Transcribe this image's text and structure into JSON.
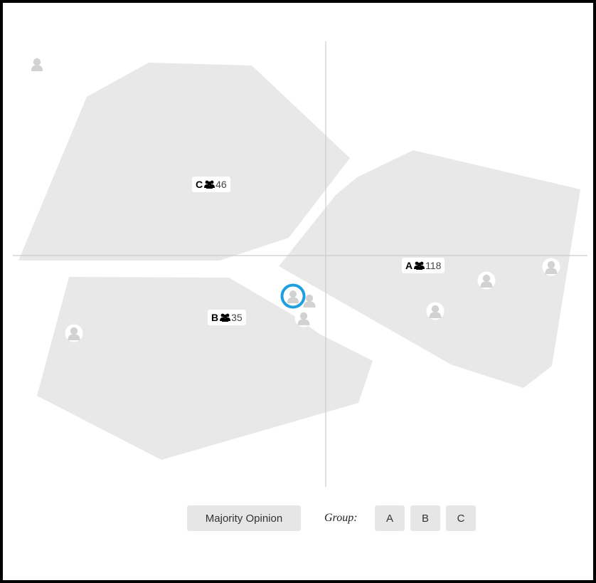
{
  "colors": {
    "region_fill": "#e8e8e8",
    "axis": "#cccccc",
    "avatar": "#d2d2d2",
    "selected_ring": "#1e9fe0",
    "button_bg": "#e6e6e6"
  },
  "groups": [
    {
      "letter": "C",
      "icon": "people-icon",
      "count": "46"
    },
    {
      "letter": "A",
      "icon": "people-icon",
      "count": "118"
    },
    {
      "letter": "B",
      "icon": "people-icon",
      "count": "35"
    }
  ],
  "controls": {
    "majority_label": "Majority Opinion",
    "group_label": "Group:",
    "group_buttons": [
      "A",
      "B",
      "C"
    ]
  },
  "participant_icon": "person-icon",
  "selected_participant_icon": "selected-person-icon"
}
